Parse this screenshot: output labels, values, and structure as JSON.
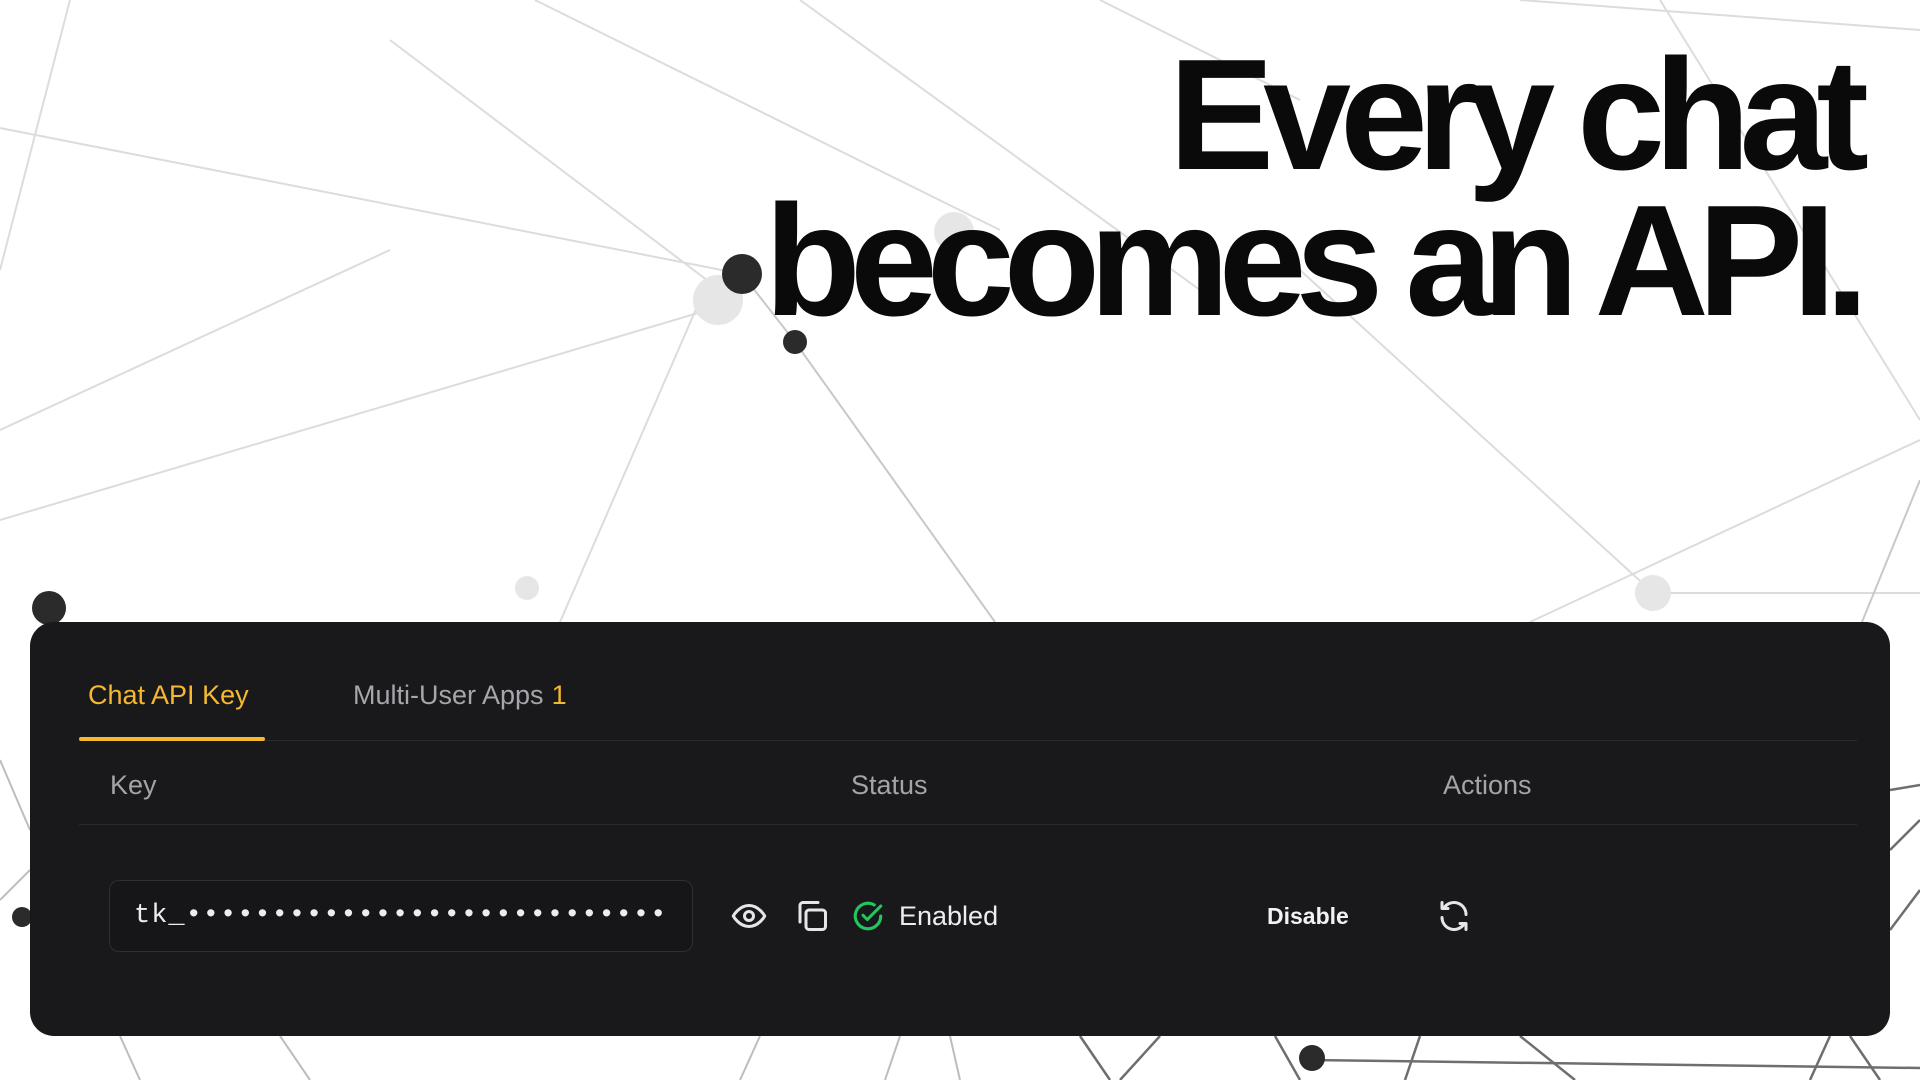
{
  "headline": {
    "line1": "Every chat",
    "line2": "becomes an API."
  },
  "tabs": [
    {
      "label": "Chat API Key",
      "active": true
    },
    {
      "label": "Multi-User Apps",
      "count": "1",
      "active": false
    }
  ],
  "table": {
    "headers": {
      "key": "Key",
      "status": "Status",
      "actions": "Actions"
    },
    "row": {
      "key_value": "tk_••••••••••••••••••••••••••••",
      "status": "Enabled",
      "disable_label": "Disable",
      "icons": [
        "eye-icon",
        "copy-icon",
        "check-circle-icon",
        "refresh-icon"
      ]
    }
  },
  "colors": {
    "accent": "#f5b82e",
    "panel_bg": "#19191b",
    "success": "#22c55e",
    "headline": "#0a0a0a"
  }
}
